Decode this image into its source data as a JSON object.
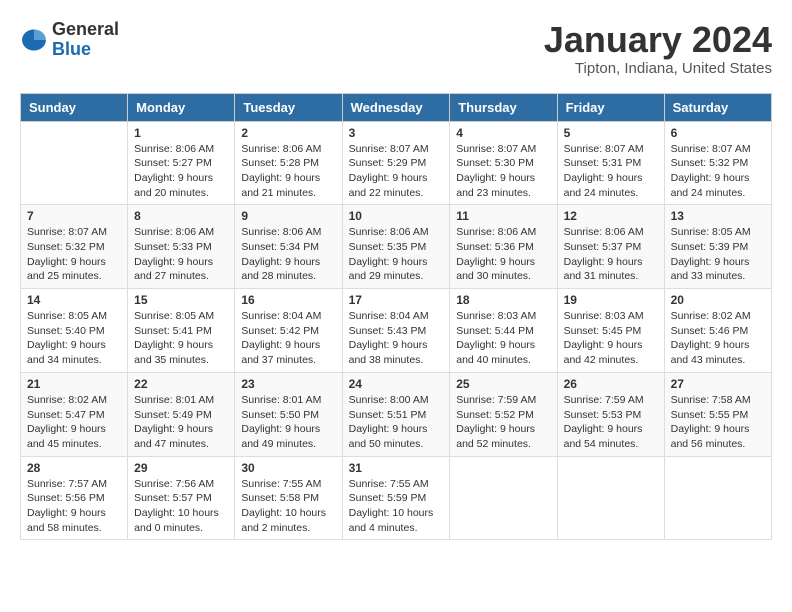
{
  "header": {
    "logo_general": "General",
    "logo_blue": "Blue",
    "month_title": "January 2024",
    "location": "Tipton, Indiana, United States"
  },
  "columns": [
    "Sunday",
    "Monday",
    "Tuesday",
    "Wednesday",
    "Thursday",
    "Friday",
    "Saturday"
  ],
  "weeks": [
    [
      {
        "day": "",
        "info": ""
      },
      {
        "day": "1",
        "info": "Sunrise: 8:06 AM\nSunset: 5:27 PM\nDaylight: 9 hours\nand 20 minutes."
      },
      {
        "day": "2",
        "info": "Sunrise: 8:06 AM\nSunset: 5:28 PM\nDaylight: 9 hours\nand 21 minutes."
      },
      {
        "day": "3",
        "info": "Sunrise: 8:07 AM\nSunset: 5:29 PM\nDaylight: 9 hours\nand 22 minutes."
      },
      {
        "day": "4",
        "info": "Sunrise: 8:07 AM\nSunset: 5:30 PM\nDaylight: 9 hours\nand 23 minutes."
      },
      {
        "day": "5",
        "info": "Sunrise: 8:07 AM\nSunset: 5:31 PM\nDaylight: 9 hours\nand 24 minutes."
      },
      {
        "day": "6",
        "info": "Sunrise: 8:07 AM\nSunset: 5:32 PM\nDaylight: 9 hours\nand 24 minutes."
      }
    ],
    [
      {
        "day": "7",
        "info": "Sunrise: 8:07 AM\nSunset: 5:32 PM\nDaylight: 9 hours\nand 25 minutes."
      },
      {
        "day": "8",
        "info": "Sunrise: 8:06 AM\nSunset: 5:33 PM\nDaylight: 9 hours\nand 27 minutes."
      },
      {
        "day": "9",
        "info": "Sunrise: 8:06 AM\nSunset: 5:34 PM\nDaylight: 9 hours\nand 28 minutes."
      },
      {
        "day": "10",
        "info": "Sunrise: 8:06 AM\nSunset: 5:35 PM\nDaylight: 9 hours\nand 29 minutes."
      },
      {
        "day": "11",
        "info": "Sunrise: 8:06 AM\nSunset: 5:36 PM\nDaylight: 9 hours\nand 30 minutes."
      },
      {
        "day": "12",
        "info": "Sunrise: 8:06 AM\nSunset: 5:37 PM\nDaylight: 9 hours\nand 31 minutes."
      },
      {
        "day": "13",
        "info": "Sunrise: 8:05 AM\nSunset: 5:39 PM\nDaylight: 9 hours\nand 33 minutes."
      }
    ],
    [
      {
        "day": "14",
        "info": "Sunrise: 8:05 AM\nSunset: 5:40 PM\nDaylight: 9 hours\nand 34 minutes."
      },
      {
        "day": "15",
        "info": "Sunrise: 8:05 AM\nSunset: 5:41 PM\nDaylight: 9 hours\nand 35 minutes."
      },
      {
        "day": "16",
        "info": "Sunrise: 8:04 AM\nSunset: 5:42 PM\nDaylight: 9 hours\nand 37 minutes."
      },
      {
        "day": "17",
        "info": "Sunrise: 8:04 AM\nSunset: 5:43 PM\nDaylight: 9 hours\nand 38 minutes."
      },
      {
        "day": "18",
        "info": "Sunrise: 8:03 AM\nSunset: 5:44 PM\nDaylight: 9 hours\nand 40 minutes."
      },
      {
        "day": "19",
        "info": "Sunrise: 8:03 AM\nSunset: 5:45 PM\nDaylight: 9 hours\nand 42 minutes."
      },
      {
        "day": "20",
        "info": "Sunrise: 8:02 AM\nSunset: 5:46 PM\nDaylight: 9 hours\nand 43 minutes."
      }
    ],
    [
      {
        "day": "21",
        "info": "Sunrise: 8:02 AM\nSunset: 5:47 PM\nDaylight: 9 hours\nand 45 minutes."
      },
      {
        "day": "22",
        "info": "Sunrise: 8:01 AM\nSunset: 5:49 PM\nDaylight: 9 hours\nand 47 minutes."
      },
      {
        "day": "23",
        "info": "Sunrise: 8:01 AM\nSunset: 5:50 PM\nDaylight: 9 hours\nand 49 minutes."
      },
      {
        "day": "24",
        "info": "Sunrise: 8:00 AM\nSunset: 5:51 PM\nDaylight: 9 hours\nand 50 minutes."
      },
      {
        "day": "25",
        "info": "Sunrise: 7:59 AM\nSunset: 5:52 PM\nDaylight: 9 hours\nand 52 minutes."
      },
      {
        "day": "26",
        "info": "Sunrise: 7:59 AM\nSunset: 5:53 PM\nDaylight: 9 hours\nand 54 minutes."
      },
      {
        "day": "27",
        "info": "Sunrise: 7:58 AM\nSunset: 5:55 PM\nDaylight: 9 hours\nand 56 minutes."
      }
    ],
    [
      {
        "day": "28",
        "info": "Sunrise: 7:57 AM\nSunset: 5:56 PM\nDaylight: 9 hours\nand 58 minutes."
      },
      {
        "day": "29",
        "info": "Sunrise: 7:56 AM\nSunset: 5:57 PM\nDaylight: 10 hours\nand 0 minutes."
      },
      {
        "day": "30",
        "info": "Sunrise: 7:55 AM\nSunset: 5:58 PM\nDaylight: 10 hours\nand 2 minutes."
      },
      {
        "day": "31",
        "info": "Sunrise: 7:55 AM\nSunset: 5:59 PM\nDaylight: 10 hours\nand 4 minutes."
      },
      {
        "day": "",
        "info": ""
      },
      {
        "day": "",
        "info": ""
      },
      {
        "day": "",
        "info": ""
      }
    ]
  ]
}
